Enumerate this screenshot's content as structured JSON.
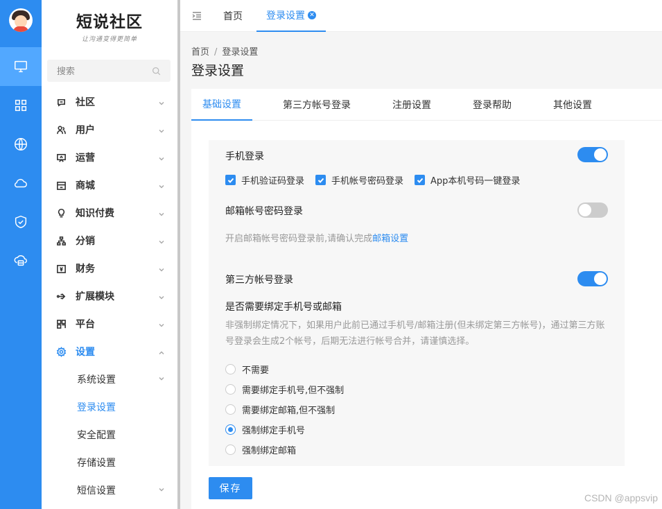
{
  "brand": {
    "title": "短说社区",
    "slogan": "让沟通变得更简单"
  },
  "search": {
    "placeholder": "搜索"
  },
  "rail_icons": [
    "monitor-icon",
    "grid-icon",
    "globe-icon",
    "cloud-icon",
    "shield-icon",
    "cloud-storage-icon"
  ],
  "menu": [
    {
      "label": "社区",
      "icon": "chat-icon"
    },
    {
      "label": "用户",
      "icon": "users-icon"
    },
    {
      "label": "运营",
      "icon": "presentation-icon"
    },
    {
      "label": "商城",
      "icon": "store-icon"
    },
    {
      "label": "知识付费",
      "icon": "bulb-icon"
    },
    {
      "label": "分销",
      "icon": "hierarchy-icon"
    },
    {
      "label": "财务",
      "icon": "finance-icon"
    },
    {
      "label": "扩展模块",
      "icon": "extension-icon"
    },
    {
      "label": "平台",
      "icon": "platform-icon"
    },
    {
      "label": "设置",
      "icon": "gear-icon"
    }
  ],
  "settings_sub": [
    "系统设置",
    "登录设置",
    "安全配置",
    "存储设置",
    "短信设置"
  ],
  "top_tabs": {
    "home": "首页",
    "current": "登录设置"
  },
  "breadcrumb": {
    "home": "首页",
    "sep": "/",
    "current": "登录设置"
  },
  "page_title": "登录设置",
  "sub_tabs": [
    "基础设置",
    "第三方帐号登录",
    "注册设置",
    "登录帮助",
    "其他设置"
  ],
  "phone_login": {
    "title": "手机登录",
    "enabled": true,
    "options": [
      "手机验证码登录",
      "手机帐号密码登录",
      "App本机号码一键登录"
    ]
  },
  "email_login": {
    "title": "邮箱帐号密码登录",
    "enabled": false,
    "hint_prefix": "开启邮箱帐号密码登录前,请确认完成",
    "hint_link": "邮箱设置"
  },
  "third_party": {
    "title": "第三方帐号登录",
    "enabled": true,
    "question": "是否需要绑定手机号或邮箱",
    "description": "非强制绑定情况下，如果用户此前已通过手机号/邮箱注册(但未绑定第三方帐号)，通过第三方账号登录会生成2个帐号，后期无法进行帐号合并，请谨慎选择。",
    "options": [
      "不需要",
      "需要绑定手机号,但不强制",
      "需要绑定邮箱,但不强制",
      "强制绑定手机号",
      "强制绑定邮箱"
    ],
    "selected": "强制绑定手机号"
  },
  "save_label": "保存",
  "watermark": "CSDN @appsvip",
  "colors": {
    "primary": "#2d8cf0",
    "rail": "#2d8cf0"
  }
}
